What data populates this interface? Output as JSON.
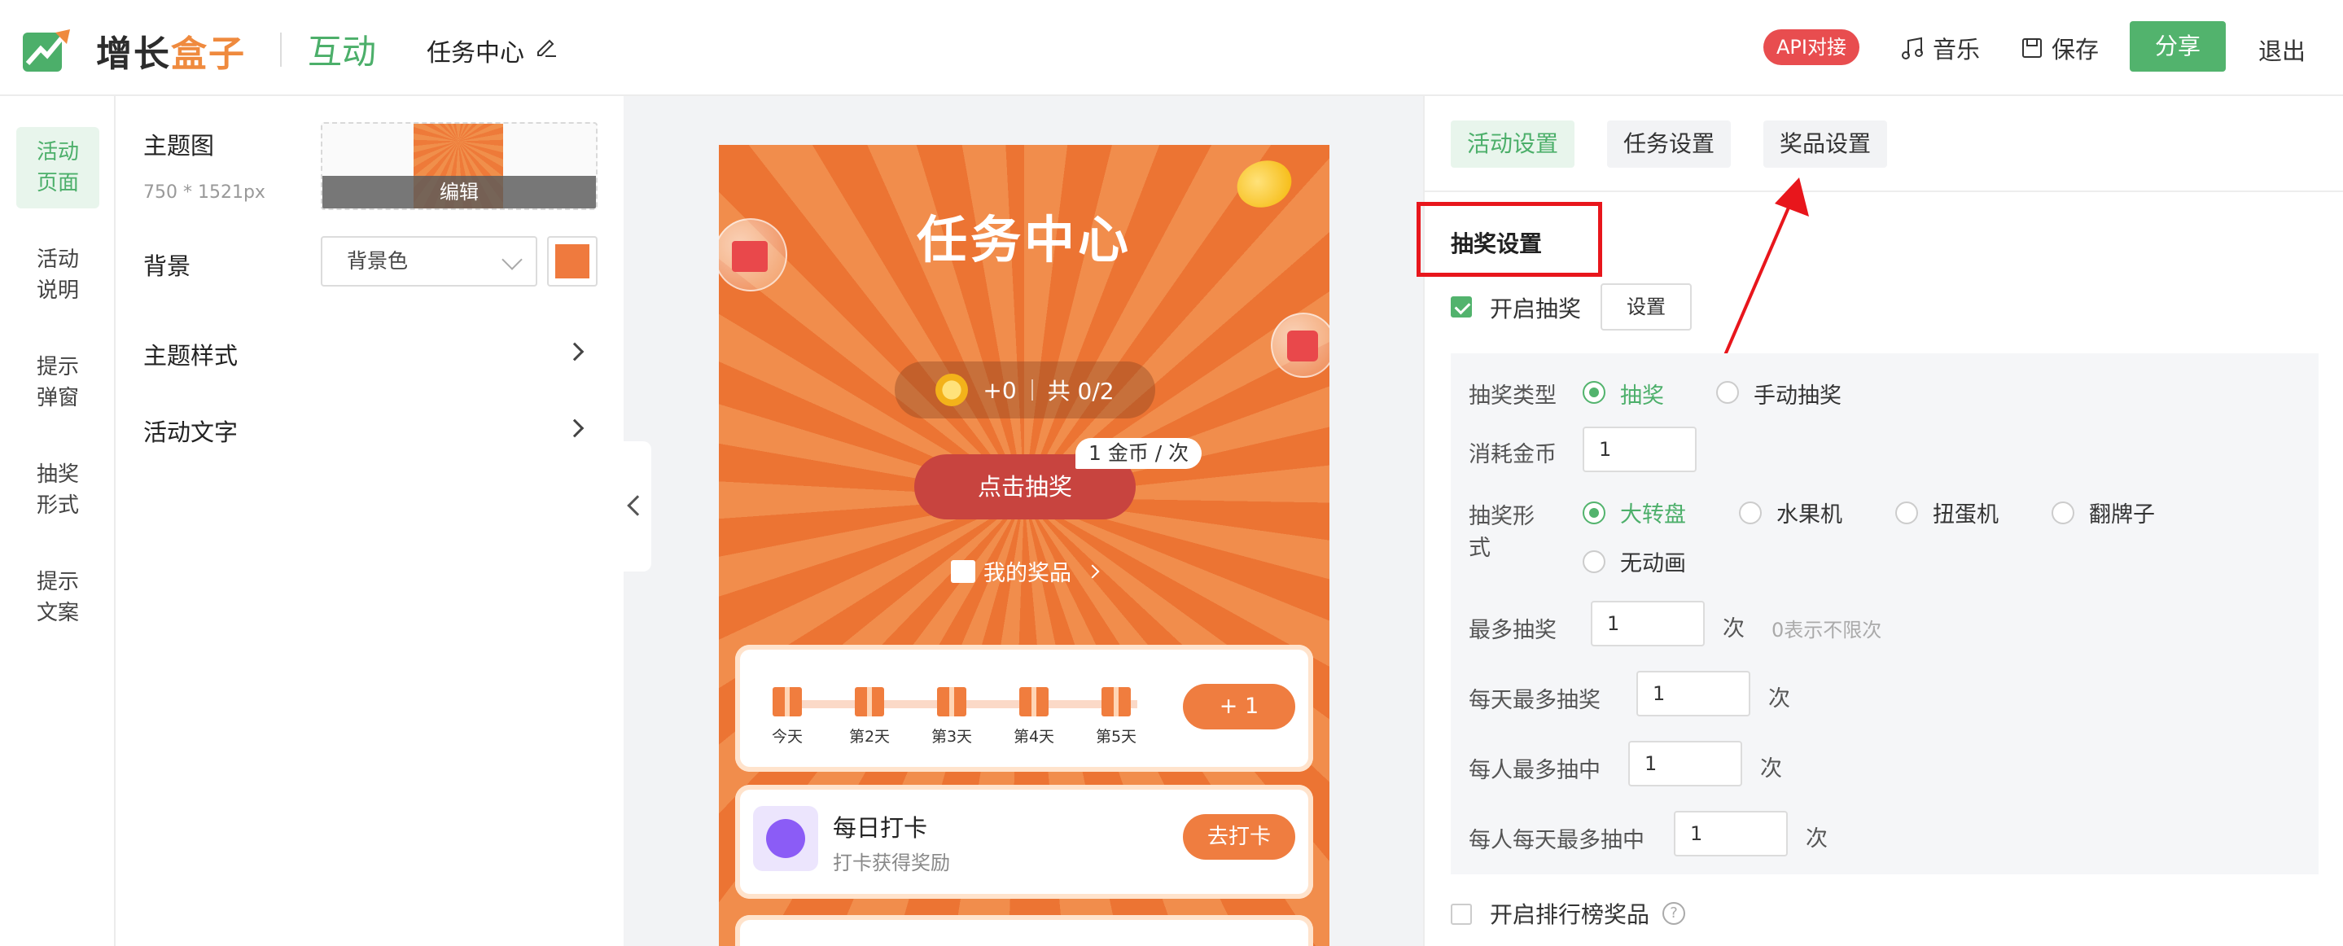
{
  "header": {
    "brand_main": "增长",
    "brand_accent": "盒子",
    "module": "互动",
    "page_name": "任务中心",
    "api_badge": "API对接",
    "music": "音乐",
    "save": "保存",
    "share": "分享",
    "exit": "退出"
  },
  "left_nav": {
    "items": [
      {
        "label": "活动页面",
        "active": true
      },
      {
        "label": "活动说明",
        "active": false
      },
      {
        "label": "提示弹窗",
        "active": false
      },
      {
        "label": "抽奖形式",
        "active": false
      },
      {
        "label": "提示文案",
        "active": false
      }
    ]
  },
  "settings": {
    "theme_label": "主题图",
    "theme_size": "750 * 1521px",
    "theme_edit": "编辑",
    "background_label": "背景",
    "background_select": "背景色",
    "background_color": "#ef7a3e",
    "theme_style": "主题样式",
    "activity_text": "活动文字"
  },
  "preview": {
    "title": "任务中心",
    "coins": "+0",
    "total": "共 0/2",
    "draw_button": "点击抽奖",
    "cost_tag": "1 金币 / 次",
    "my_prize": "我的奖品",
    "days": [
      "今天",
      "第2天",
      "第3天",
      "第4天",
      "第5天"
    ],
    "plus_button": "+ 1",
    "task_title": "每日打卡",
    "task_subtitle": "打卡获得奖励",
    "task_button": "去打卡"
  },
  "right_panel": {
    "tabs": [
      {
        "label": "活动设置",
        "active": true
      },
      {
        "label": "任务设置",
        "active": false
      },
      {
        "label": "奖品设置",
        "active": false
      }
    ],
    "section_title": "抽奖设置",
    "enable_draw": "开启抽奖",
    "enable_draw_checked": true,
    "set_button": "设置",
    "draw_type_label": "抽奖类型",
    "draw_type_options": [
      "抽奖",
      "手动抽奖"
    ],
    "draw_type_selected": "抽奖",
    "cost_label": "消耗金币",
    "cost_value": "1",
    "form_label_1": "抽奖形",
    "form_label_2": "式",
    "form_options": [
      "大转盘",
      "水果机",
      "扭蛋机",
      "翻牌子",
      "无动画"
    ],
    "form_selected": "大转盘",
    "max_draw_label": "最多抽奖",
    "max_draw_value": "1",
    "unit": "次",
    "max_draw_hint": "0表示不限次",
    "daily_max_label": "每天最多抽奖",
    "daily_max_value": "1",
    "person_max_win_label": "每人最多抽中",
    "person_max_win_value": "1",
    "person_daily_max_win_label": "每人每天最多抽中",
    "person_daily_max_win_value": "1",
    "leaderboard_label": "开启排行榜奖品",
    "leaderboard_checked": false
  }
}
